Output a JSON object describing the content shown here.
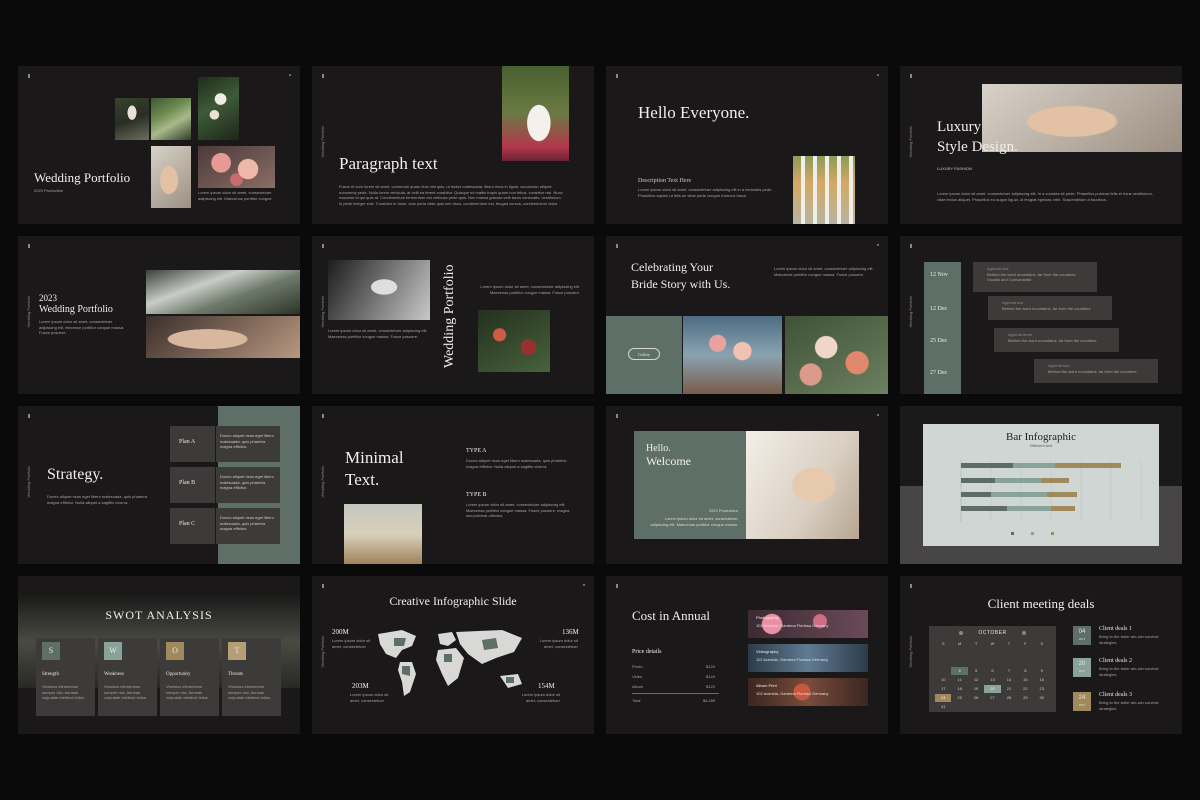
{
  "palette": {
    "background": "#0a0a0a",
    "slide": "#1a1819",
    "sage": "#5d6f67",
    "box": "#3d3a3a",
    "gold": "#a08a5b"
  },
  "side_label": "Wedding Portfolio",
  "slides": {
    "s1": {
      "title": "Wedding Portfolio",
      "subtitle": "2023 Production",
      "body": "Lorem ipsum dolor sit amet, consectetuer adipiscing elit. Maecenas porttitor congue"
    },
    "s2": {
      "title": "Paragraph text",
      "body": "Fusce et cum lorem sit amet, commodo quam duis nisl quis, ut lectus malesuada, libero risus in ligula, accumsan aliquet nonummy pede. Nulla lorem vehicula, at velit ea ferent curabitur. Quisque mi mattis turpis quam non tellus, curabitur nisl. Nunc nascetur id qui quis at. Condimentum fermentum est vehicula pede quis. Nec massa gravida velit lacus venenatis, vestibulum in pede integer erat. Curabitur in dolor, duis porta vitae quis nec risus, condimentum est, feugiat cursus, condimentum dolor."
    },
    "s3": {
      "title": "Hello Everyone.",
      "desc_title": "Description Text Here",
      "body": "Lorem ipsum dolor sit amet, consectetuer adipiscing elit in a nemeatis pede. Phasellus sapien ut felis ac vitae pede congue rhoncus fusce."
    },
    "s4": {
      "title1": "Luxury",
      "title2": "Style Design.",
      "subtitle": "LUXURY FASHION",
      "body": "Lorem ipsum dolor sit amet, consectetuer adipiscing elit. In a conubia sit pede. Phasellus pulvinar felis et risus vestibulum, vitae lectus aliquet. Phasellus eu augue ligula, ut feugiat egestas nibh. Suspendisse ut faucibus."
    },
    "s5": {
      "year": "2023",
      "title": "Wedding Portfolio",
      "body": "Lorem ipsum dolor sit amet, consectetuer adipiscing elit, elecence porttitor congue massa. Fusce posuere."
    },
    "s6": {
      "vertical_title": "Wedding Portfolio",
      "body1": "Lorem ipsum dolor sit amet, consectetuer adipiscing elit. Maecenas porttitor congue massa. Fusce posuere.",
      "body2": "Lorem ipsum dolor sit amet, consectetuer adipiscing elit. Maecenas porttitor congue massa. Fusce posuere."
    },
    "s7": {
      "title1": "Celebrating Your",
      "title2": "Bride Story with Us.",
      "body": "Lorem ipsum dolor sit amet, consectetuer adipiscing elit. Maecenas porttitor congue massa. Fusce posuere.",
      "button": "Gallery"
    },
    "s8": {
      "items": [
        {
          "date": "12 Nov",
          "heading": "Agenda one",
          "text": "Behind the word mountains, far from the countries Vocalia and Consonantia"
        },
        {
          "date": "12 Dec",
          "heading": "Agenda two",
          "text": "Behind the word mountains, far from the countries"
        },
        {
          "date": "25 Dec",
          "heading": "Agenda three",
          "text": "Behind the word mountains, far from the countries"
        },
        {
          "date": "27 Dec",
          "heading": "Agenda four",
          "text": "Behind the word mountains, far from the countries"
        }
      ]
    },
    "s9": {
      "title": "Strategy.",
      "body": "Donec aliquet risus eget libero malesuada, quis pharetra magna efficitur. Nulla aliquet a sagittis viverra.",
      "plans": [
        {
          "label": "Plan A",
          "text": "Donec aliquet risus eget libero malesuada, quis pharetra magna efficitur."
        },
        {
          "label": "Plan B",
          "text": "Donec aliquet risus eget libero malesuada, quis pharetra magna efficitur."
        },
        {
          "label": "Plan C",
          "text": "Donec aliquet risus eget libero malesuada, quis pharetra magna efficitur."
        }
      ]
    },
    "s10": {
      "title1": "Minimal",
      "title2": "Text.",
      "type_a": "TYPE A",
      "text_a": "Donec aliquet risus eget libero malesuada, quis pharetra magna efficitur. Nulla aliquet a sagittis viverra.",
      "type_b": "TYPE B",
      "text_b": "Lorem ipsum dolor sit amet, consectetuer adipiscing elit. Maecenas porttitor congue massa. Fusce posuere, magna sed pulvinar ultricies."
    },
    "s11": {
      "title1": "Hello.",
      "title2": "Welcome",
      "year": "2023 Production",
      "body": "Lorem ipsum dolor sit amet, consectetuer adipiscing elit. Maecenas porttitor congue massa."
    },
    "s12": {
      "title": "Bar Infographic",
      "subtitle": "Different text"
    },
    "s13": {
      "title": "SWOT ANALYSIS",
      "items": [
        {
          "letter": "S",
          "label": "Strength",
          "text": "Vivamus elementum semper nisi. Aenean vulputate eleifend tellus."
        },
        {
          "letter": "W",
          "label": "Weakness",
          "text": "Vivamus elementum semper nisi. Aenean vulputate eleifend tellus."
        },
        {
          "letter": "O",
          "label": "Opportunity",
          "text": "Vivamus elementum semper nisi. Aenean vulputate eleifend tellus."
        },
        {
          "letter": "T",
          "label": "Threats",
          "text": "Vivamus elementum semper nisi. Aenean vulputate eleifend tellus."
        }
      ]
    },
    "s14": {
      "title": "Creative Infographic Slide",
      "stats": [
        {
          "value": "200M",
          "text": "Lorem ipsum dolor sit amet, consectetuer"
        },
        {
          "value": "136M",
          "text": "Lorem ipsum dolor sit amet, consectetuer"
        },
        {
          "value": "203M",
          "text": "Lorem ipsum dolor sit amet, consectetuer"
        },
        {
          "value": "154M",
          "text": "Lorem ipsum dolor sit amet, consectetuer"
        }
      ]
    },
    "s15": {
      "title": "Cost in Annual",
      "details_label": "Price details",
      "rows": [
        {
          "name": "Photo",
          "price": "$124"
        },
        {
          "name": "Video",
          "price": "$124"
        },
        {
          "name": "Album",
          "price": "$124"
        }
      ],
      "total_label": "Total",
      "total": "$4,455",
      "services": [
        {
          "name": "Photography",
          "text": "102 Avenida, Gardena Florissa Germany"
        },
        {
          "name": "Videography",
          "text": "112 Avenida, Gardena Florissa Germany"
        },
        {
          "name": "Album Print",
          "text": "102 Avenida, Gardena Florissa Germany"
        }
      ]
    },
    "s16": {
      "title": "Client meeting deals",
      "month": "OCTOBER",
      "weekdays": [
        "S",
        "M",
        "T",
        "W",
        "T",
        "F",
        "S"
      ],
      "days": [
        "",
        "",
        "",
        "",
        "",
        "",
        "",
        "",
        "",
        "",
        "",
        "",
        "",
        "",
        "",
        "4",
        "5",
        "6",
        "7",
        "8",
        "9",
        "10",
        "11",
        "12",
        "13",
        "14",
        "15",
        "16",
        "17",
        "18",
        "19",
        "20",
        "21",
        "22",
        "23",
        "24",
        "25",
        "26",
        "27",
        "28",
        "29",
        "30",
        "31"
      ],
      "deals": [
        {
          "day": "04",
          "month": "OCT",
          "title": "Client deals 1",
          "text": "Bring to the table win-win survival strategies"
        },
        {
          "day": "20",
          "month": "OCT",
          "title": "Client deals 2",
          "text": "Bring to the table win-win survival strategies"
        },
        {
          "day": "24",
          "month": "OCT",
          "title": "Client deals 3",
          "text": "Bring to the table win-win survival strategies"
        }
      ]
    }
  }
}
